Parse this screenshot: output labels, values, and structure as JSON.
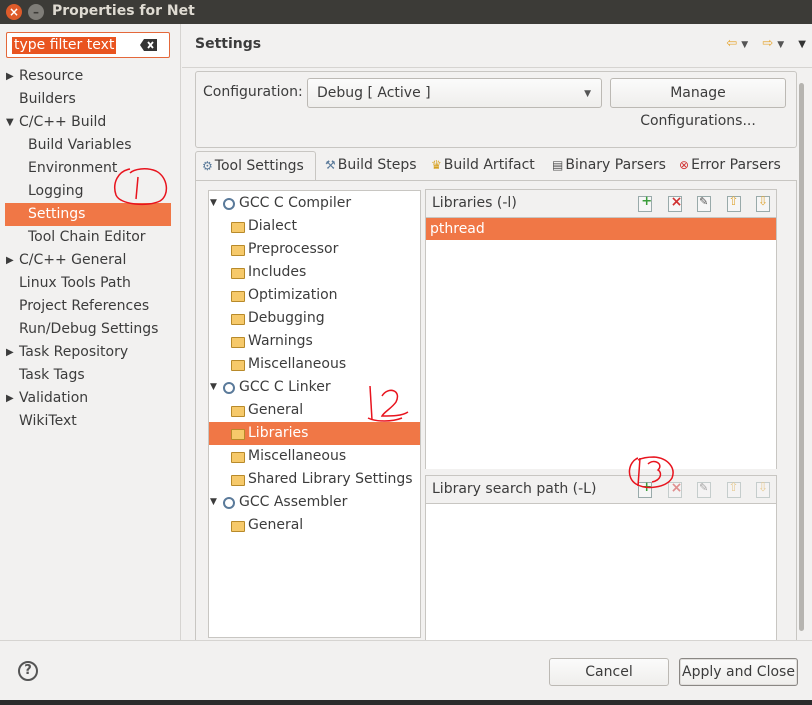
{
  "window": {
    "title": "Properties for Net"
  },
  "filter": {
    "placeholder": "type filter text"
  },
  "sidebar": {
    "items": [
      {
        "label": "Resource"
      },
      {
        "label": "Builders"
      },
      {
        "label": "C/C++ Build"
      },
      {
        "label": "Build Variables"
      },
      {
        "label": "Environment"
      },
      {
        "label": "Logging"
      },
      {
        "label": "Settings"
      },
      {
        "label": "Tool Chain Editor"
      },
      {
        "label": "C/C++ General"
      },
      {
        "label": "Linux Tools Path"
      },
      {
        "label": "Project References"
      },
      {
        "label": "Run/Debug Settings"
      },
      {
        "label": "Task Repository"
      },
      {
        "label": "Task Tags"
      },
      {
        "label": "Validation"
      },
      {
        "label": "WikiText"
      }
    ]
  },
  "header": {
    "title": "Settings"
  },
  "configuration": {
    "label": "Configuration:",
    "value": "Debug  [ Active ]",
    "manage_label": "Manage Configurations..."
  },
  "tabs": [
    {
      "label": "Tool Settings"
    },
    {
      "label": "Build Steps"
    },
    {
      "label": "Build Artifact"
    },
    {
      "label": "Binary Parsers"
    },
    {
      "label": "Error Parsers"
    }
  ],
  "tool_tree": [
    {
      "label": "GCC C Compiler"
    },
    {
      "label": "Dialect"
    },
    {
      "label": "Preprocessor"
    },
    {
      "label": "Includes"
    },
    {
      "label": "Optimization"
    },
    {
      "label": "Debugging"
    },
    {
      "label": "Warnings"
    },
    {
      "label": "Miscellaneous"
    },
    {
      "label": "GCC C Linker"
    },
    {
      "label": "General"
    },
    {
      "label": "Libraries"
    },
    {
      "label": "Miscellaneous"
    },
    {
      "label": "Shared Library Settings"
    },
    {
      "label": "GCC Assembler"
    },
    {
      "label": "General"
    }
  ],
  "libraries": {
    "title": "Libraries (-l)",
    "items": [
      "pthread"
    ]
  },
  "library_paths": {
    "title": "Library search path (-L)",
    "items": []
  },
  "footer": {
    "help": "?",
    "cancel_label": "Cancel",
    "apply_label": "Apply and Close"
  },
  "colors": {
    "accent": "#f07746",
    "annotation": "#e8141e",
    "titlebar": "#3c3b37"
  }
}
